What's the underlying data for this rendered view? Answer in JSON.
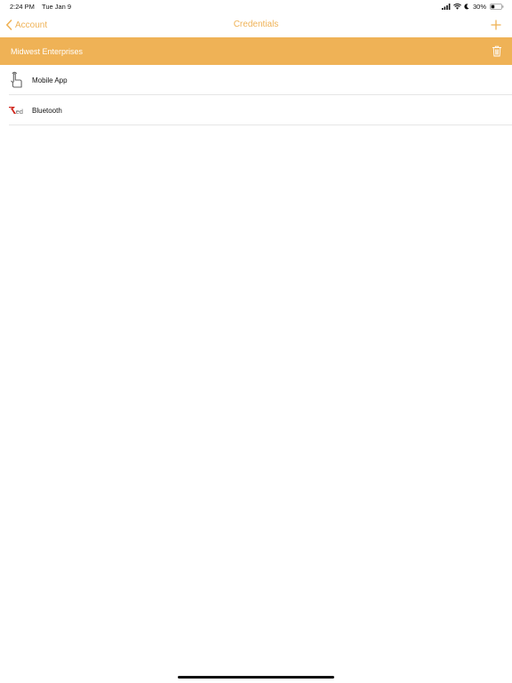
{
  "status_bar": {
    "time": "2:24 PM",
    "date": "Tue Jan 9",
    "battery": "30%",
    "icons": [
      "signal-icon",
      "wifi-icon",
      "moon-icon",
      "battery-icon"
    ]
  },
  "nav": {
    "back_label": "Account",
    "title": "Credentials",
    "add_icon": "plus-icon"
  },
  "section": {
    "title": "Midwest Enterprises",
    "delete_icon": "trash-icon"
  },
  "credentials": [
    {
      "label": "Mobile App",
      "icon": "touch-hand-icon"
    },
    {
      "label": "Bluetooth",
      "icon": "red-logo-icon"
    }
  ],
  "colors": {
    "accent": "#efb256",
    "header_text": "#ffffff",
    "logo_red": "#d0251c"
  }
}
